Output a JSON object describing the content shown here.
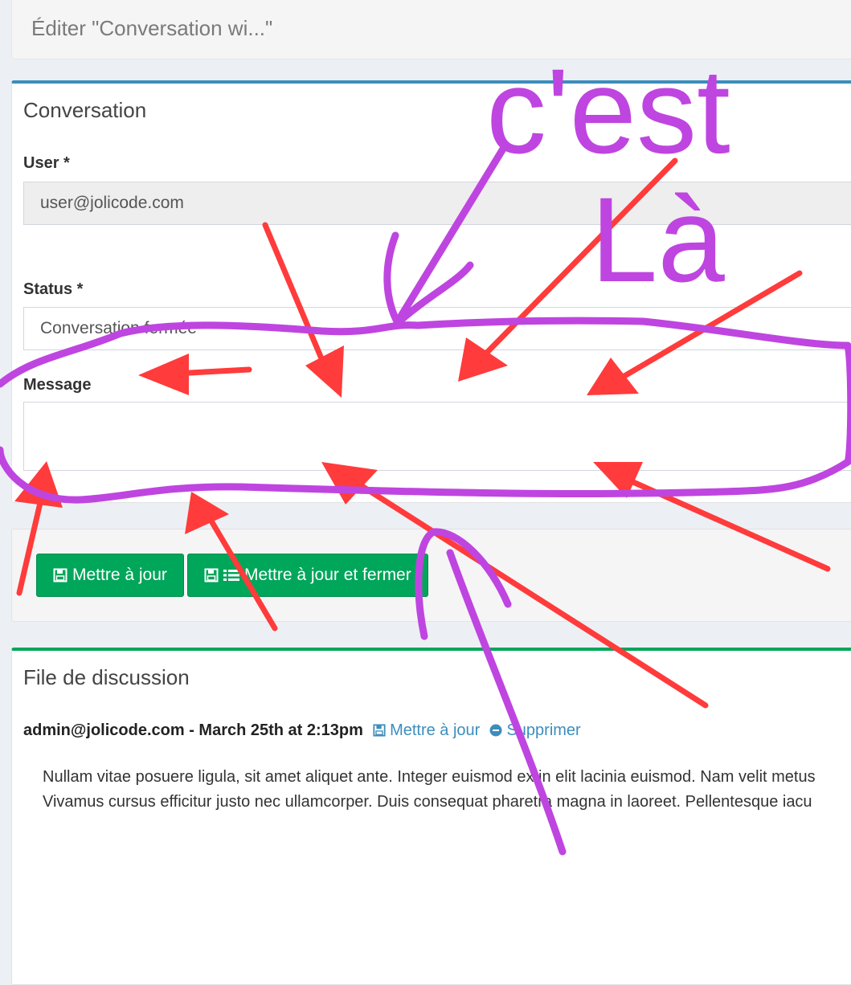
{
  "header": {
    "title": "Éditer \"Conversation wi...\""
  },
  "form": {
    "title": "Conversation",
    "user": {
      "label": "User *",
      "value": "user@jolicode.com"
    },
    "status": {
      "label": "Status *",
      "value": "Conversation fermée"
    },
    "message": {
      "label": "Message",
      "value": ""
    }
  },
  "actions": {
    "update_label": "Mettre à jour",
    "update_close_label": "Mettre à jour et fermer"
  },
  "thread": {
    "title": "File de discussion",
    "author_line": "admin@jolicode.com - March 25th at 2:13pm",
    "update_link": "Mettre à jour",
    "delete_link": "Supprimer",
    "message_line1": "Nullam vitae posuere ligula, sit amet aliquet ante. Integer euismod ex in elit lacinia euismod. Nam velit metus",
    "message_line2": "Vivamus cursus efficitur justo nec ullamcorper. Duis consequat pharetra magna in laoreet. Pellentesque iacu"
  },
  "annotation": {
    "handwritten_text_line1": "c'est",
    "handwritten_text_line2": "Là",
    "purple": "#bf45e0",
    "red": "#ff3b3b"
  },
  "colors": {
    "primary": "#3c8dbc",
    "success": "#00a65a"
  }
}
